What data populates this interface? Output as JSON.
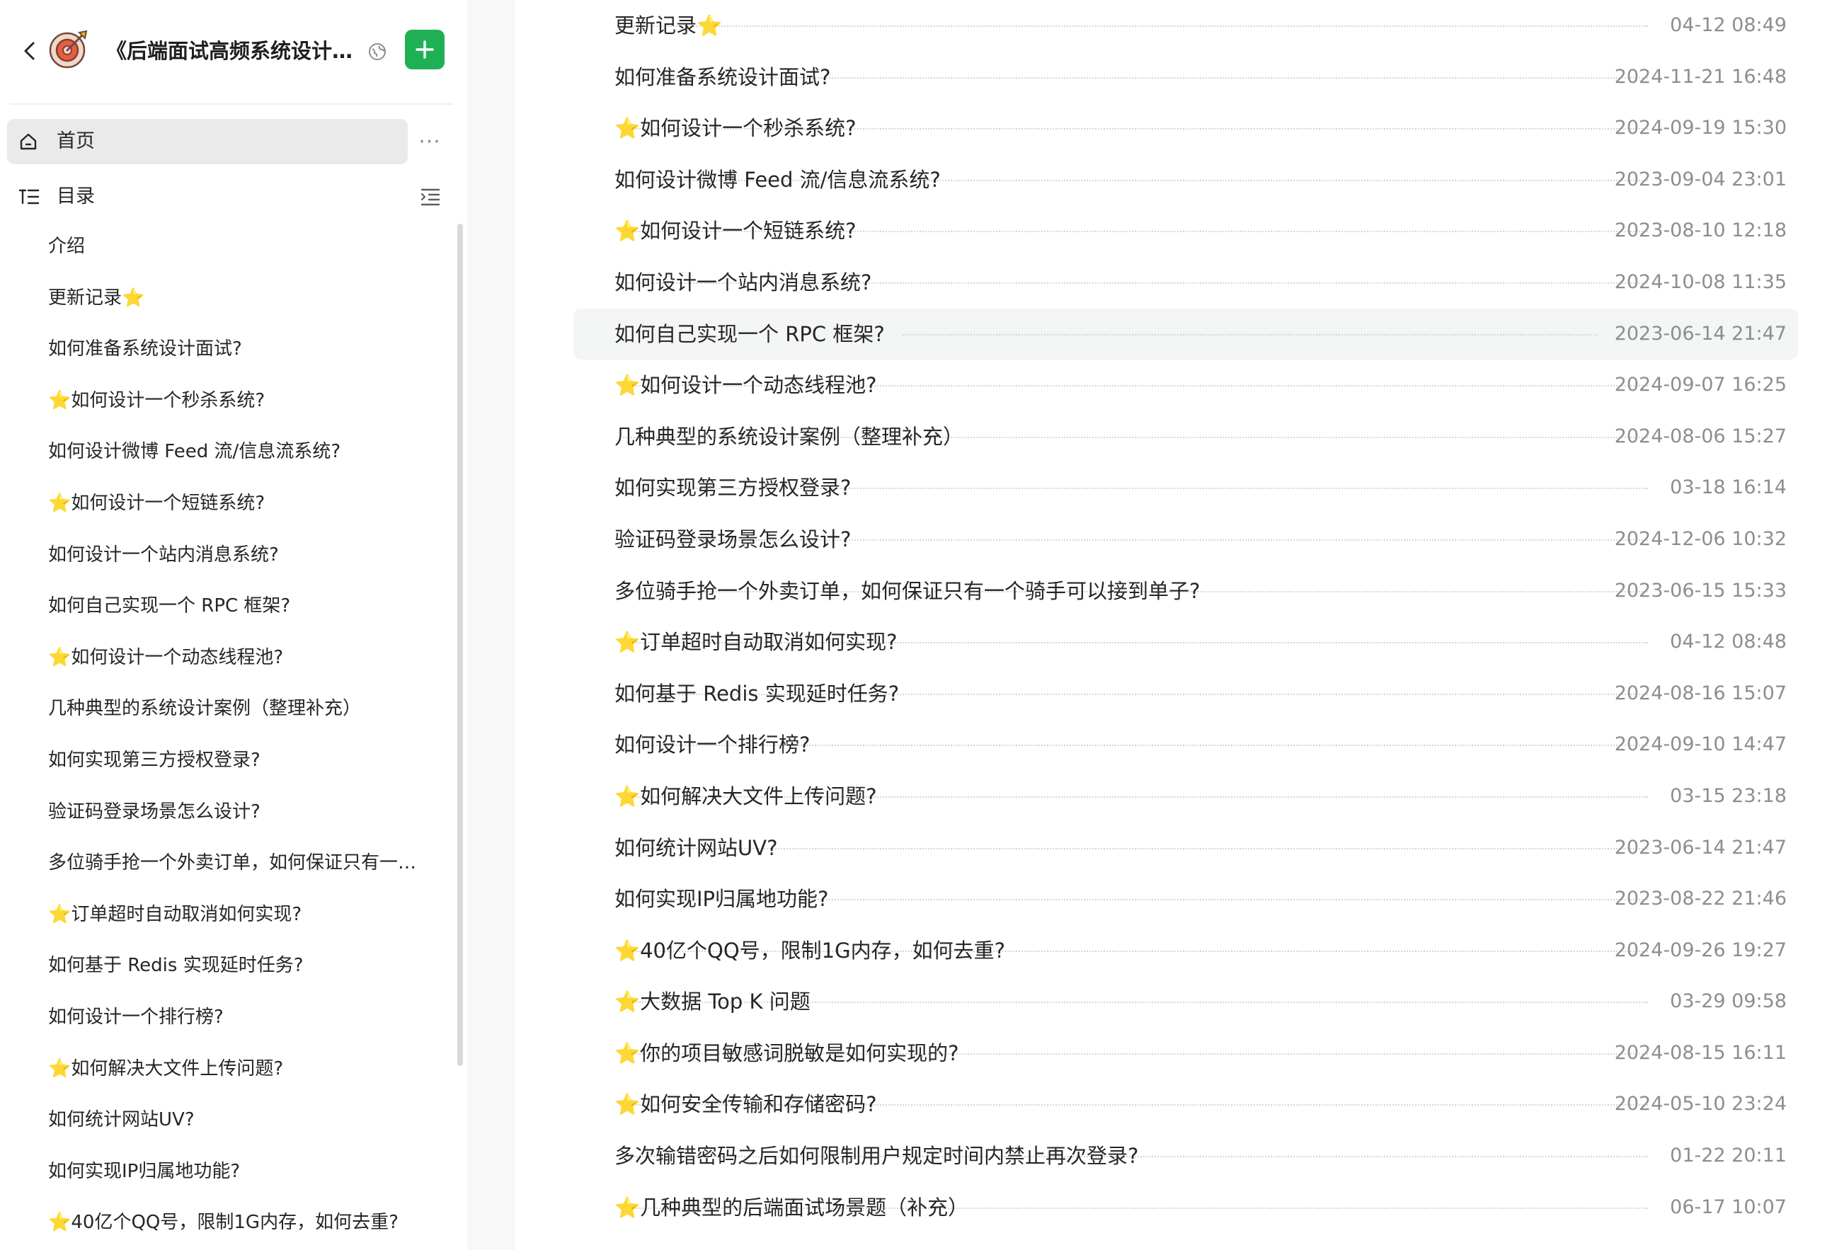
{
  "book": {
    "title": "《后端面试高频系统设计&场景题》"
  },
  "colors": {
    "accent": "#1fb056",
    "selected_bg": "#eaeaea",
    "hover_bg": "#f4f5f5",
    "date_text": "#8a8f8d"
  },
  "icons": {
    "back": "chevron-left-icon",
    "logo": "dartboard-logo",
    "visibility": "public-globe-icon",
    "add": "plus-icon",
    "home": "home-icon",
    "more": "more-horizontal-icon",
    "toc": "toc-list-icon",
    "toc_toggle": "collapse-list-icon"
  },
  "nav": {
    "home_label": "首页",
    "more_label": "···",
    "toc_label": "目录"
  },
  "toc": [
    {
      "label": "介绍"
    },
    {
      "label": "更新记录⭐"
    },
    {
      "label": "如何准备系统设计面试?"
    },
    {
      "label": "⭐如何设计一个秒杀系统?"
    },
    {
      "label": "如何设计微博 Feed 流/信息流系统?"
    },
    {
      "label": "⭐如何设计一个短链系统?"
    },
    {
      "label": "如何设计一个站内消息系统?"
    },
    {
      "label": "如何自己实现一个 RPC 框架?"
    },
    {
      "label": "⭐如何设计一个动态线程池?"
    },
    {
      "label": "几种典型的系统设计案例（整理补充）"
    },
    {
      "label": "如何实现第三方授权登录?"
    },
    {
      "label": "验证码登录场景怎么设计?"
    },
    {
      "label": "多位骑手抢一个外卖订单，如何保证只有一个骑手可以接到单子?"
    },
    {
      "label": "⭐订单超时自动取消如何实现?"
    },
    {
      "label": "如何基于 Redis 实现延时任务?"
    },
    {
      "label": "如何设计一个排行榜?"
    },
    {
      "label": "⭐如何解决大文件上传问题?"
    },
    {
      "label": "如何统计网站UV?"
    },
    {
      "label": "如何实现IP归属地功能?"
    },
    {
      "label": "⭐40亿个QQ号，限制1G内存，如何去重?"
    }
  ],
  "catalog": [
    {
      "title": "更新记录⭐",
      "date": "04-12 08:49"
    },
    {
      "title": "如何准备系统设计面试?",
      "date": "2024-11-21 16:48"
    },
    {
      "title": "⭐如何设计一个秒杀系统?",
      "date": "2024-09-19 15:30"
    },
    {
      "title": "如何设计微博 Feed 流/信息流系统?",
      "date": "2023-09-04 23:01"
    },
    {
      "title": "⭐如何设计一个短链系统?",
      "date": "2023-08-10 12:18"
    },
    {
      "title": "如何设计一个站内消息系统?",
      "date": "2024-10-08 11:35"
    },
    {
      "title": "如何自己实现一个 RPC 框架?",
      "date": "2023-06-14 21:47"
    },
    {
      "title": "⭐如何设计一个动态线程池?",
      "date": "2024-09-07 16:25"
    },
    {
      "title": "几种典型的系统设计案例（整理补充）",
      "date": "2024-08-06 15:27"
    },
    {
      "title": "如何实现第三方授权登录?",
      "date": "03-18 16:14"
    },
    {
      "title": "验证码登录场景怎么设计?",
      "date": "2024-12-06 10:32"
    },
    {
      "title": "多位骑手抢一个外卖订单，如何保证只有一个骑手可以接到单子?",
      "date": "2023-06-15 15:33"
    },
    {
      "title": "⭐订单超时自动取消如何实现?",
      "date": "04-12 08:48"
    },
    {
      "title": "如何基于 Redis 实现延时任务?",
      "date": "2024-08-16 15:07"
    },
    {
      "title": "如何设计一个排行榜?",
      "date": "2024-09-10 14:47"
    },
    {
      "title": "⭐如何解决大文件上传问题?",
      "date": "03-15 23:18"
    },
    {
      "title": "如何统计网站UV?",
      "date": "2023-06-14 21:47"
    },
    {
      "title": "如何实现IP归属地功能?",
      "date": "2023-08-22 21:46"
    },
    {
      "title": "⭐40亿个QQ号，限制1G内存，如何去重?",
      "date": "2024-09-26 19:27"
    },
    {
      "title": "⭐大数据 Top K 问题",
      "date": "03-29 09:58"
    },
    {
      "title": "⭐你的项目敏感词脱敏是如何实现的?",
      "date": "2024-08-15 16:11"
    },
    {
      "title": "⭐如何安全传输和存储密码?",
      "date": "2024-05-10 23:24"
    },
    {
      "title": "多次输错密码之后如何限制用户规定时间内禁止再次登录?",
      "date": "01-22 20:11"
    },
    {
      "title": "⭐几种典型的后端面试场景题（补充）",
      "date": "06-17 10:07"
    }
  ],
  "hovered_row_index": 6
}
